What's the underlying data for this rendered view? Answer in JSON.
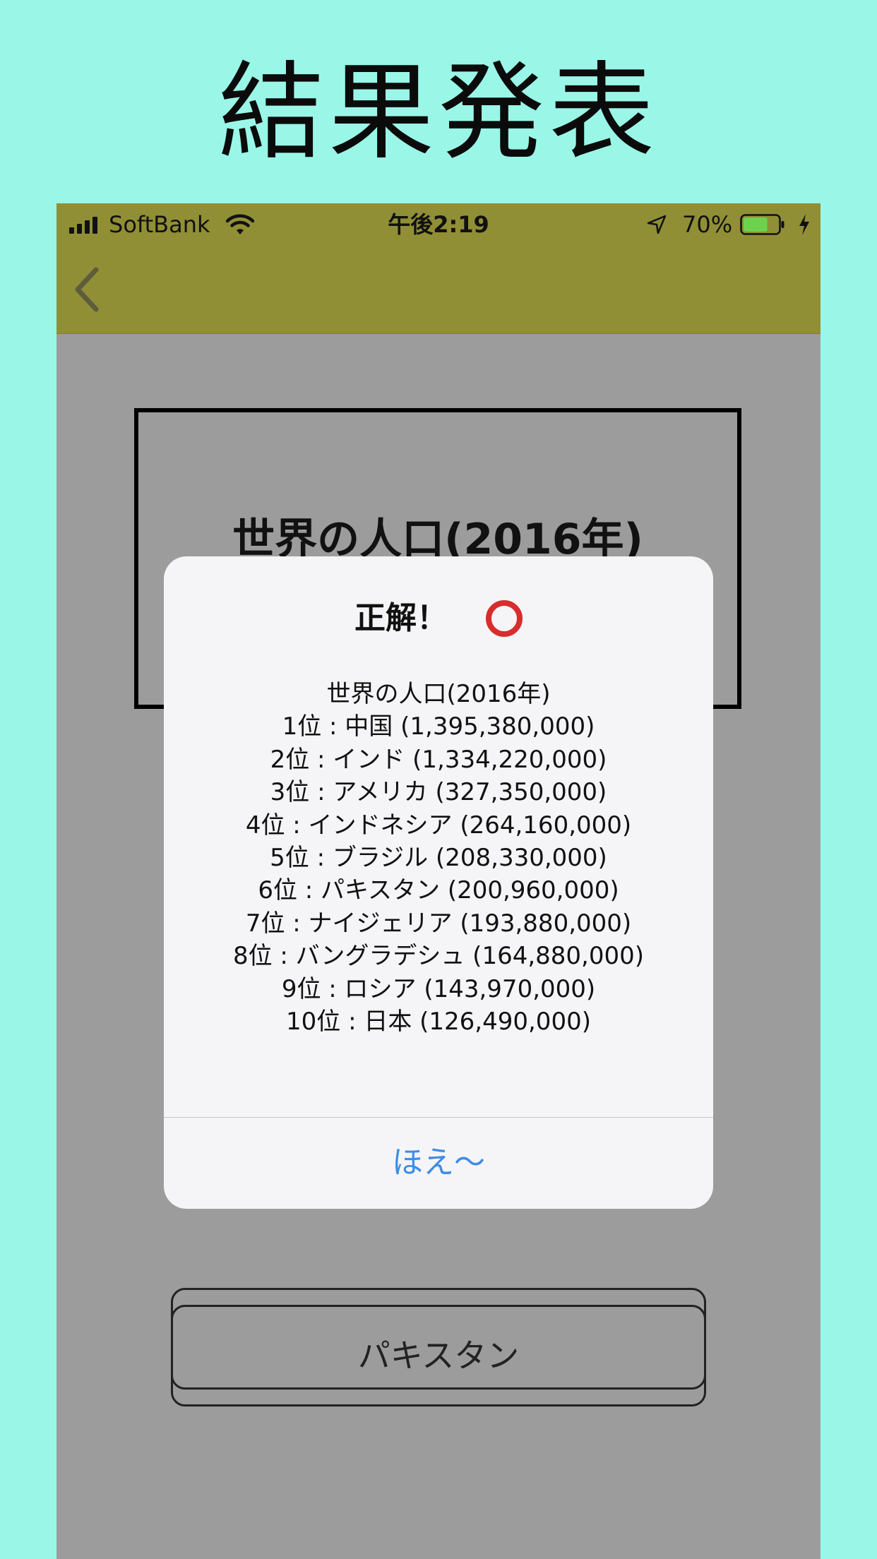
{
  "promo": {
    "title": "結果発表"
  },
  "status_bar": {
    "carrier": "SoftBank",
    "time": "午後2:19",
    "battery_percent": "70%",
    "battery_level": 0.7,
    "icons": [
      "signal-icon",
      "wifi-icon",
      "location-icon",
      "battery-icon",
      "charging-bolt-icon"
    ]
  },
  "nav": {
    "back_icon": "chevron-left-icon"
  },
  "question": {
    "title": "世界の人口(2016年)"
  },
  "answers": {
    "hidden_label": "",
    "pakistan_label": "パキスタン"
  },
  "alert": {
    "title": "正解！",
    "result_icon": "red-circle-icon",
    "message_title": "世界の人口(2016年)",
    "ranking": [
      "1位 : 中国 (1,395,380,000)",
      "2位 : インド (1,334,220,000)",
      "3位 : アメリカ (327,350,000)",
      "4位 : インドネシア (264,160,000)",
      "5位 : ブラジル (208,330,000)",
      "6位 : パキスタン (200,960,000)",
      "7位 : ナイジェリア (193,880,000)",
      "8位 : バングラデシュ (164,880,000)",
      "9位 : ロシア (143,970,000)",
      "10位 : 日本 (126,490,000)"
    ],
    "button_label": "ほえ〜"
  },
  "colors": {
    "page_background": "#9af7e8",
    "nav_bar": "#908f36",
    "dim_overlay": "#9c9c9c",
    "alert_background": "#f5f5f7",
    "alert_button_text": "#3f8de5",
    "correct_circle": "#d72d2d"
  }
}
